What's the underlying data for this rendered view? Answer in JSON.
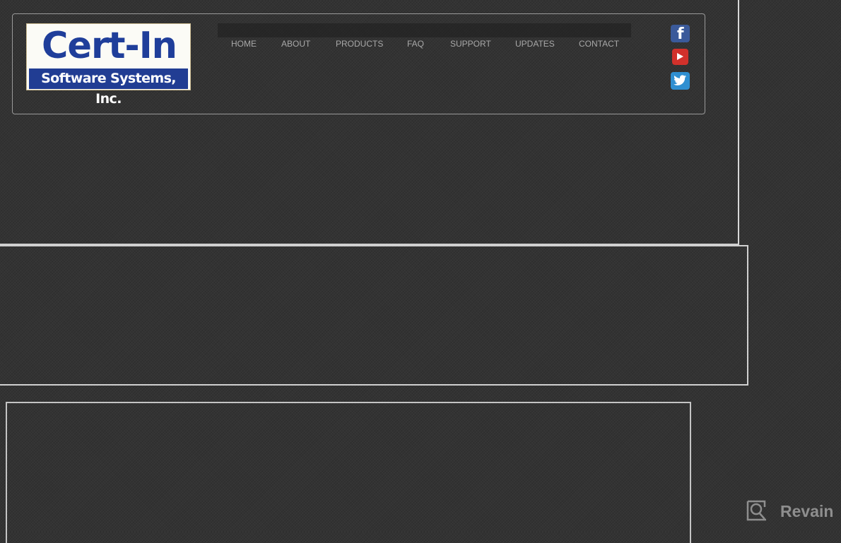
{
  "logo": {
    "title": "Cert-In",
    "subtitle": "Software Systems, Inc."
  },
  "nav": {
    "items": [
      {
        "label": "HOME"
      },
      {
        "label": "ABOUT"
      },
      {
        "label": "PRODUCTS"
      },
      {
        "label": "FAQ"
      },
      {
        "label": "SUPPORT"
      },
      {
        "label": "UPDATES"
      },
      {
        "label": "CONTACT"
      }
    ]
  },
  "social": {
    "facebook": "f",
    "youtube": "youtube-icon",
    "twitter": "twitter-icon"
  },
  "colors": {
    "brand_blue": "#213d93",
    "background": "#333333",
    "nav_text": "#a8a8a8"
  },
  "watermark": {
    "label": "Revain"
  }
}
